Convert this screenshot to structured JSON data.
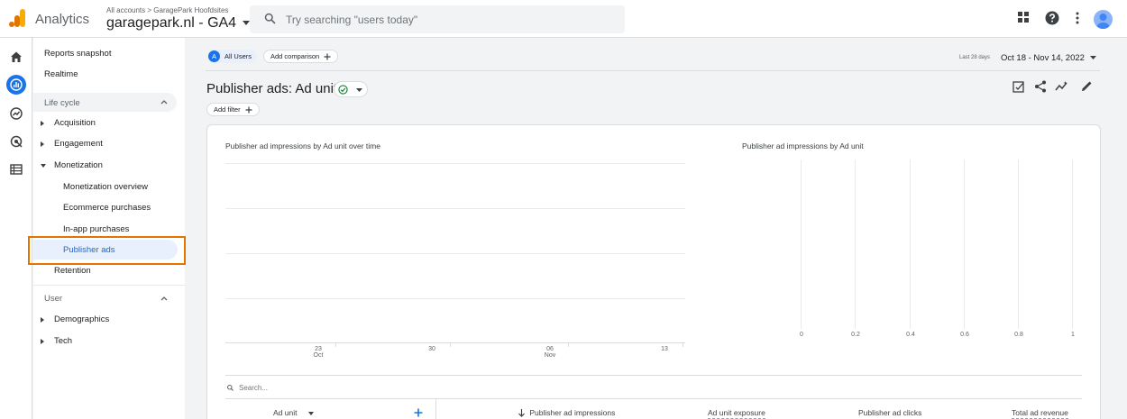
{
  "topbar": {
    "app_name": "Analytics",
    "accounts_label": "All accounts",
    "accounts_separator": ">",
    "account_name": "GaragePark Hoofdsites",
    "property_name": "garagepark.nl - GA4",
    "search_placeholder": "Try searching \"users today\"",
    "icons": [
      "apps-icon",
      "help-icon",
      "more-vert-icon",
      "avatar"
    ]
  },
  "rail": {
    "icons": [
      "home-icon",
      "reports-icon",
      "explore-icon",
      "advertising-icon",
      "configure-icon"
    ],
    "active": "reports-icon"
  },
  "nav": {
    "reports_snapshot": "Reports snapshot",
    "realtime": "Realtime",
    "lifecycle_section": "Life cycle",
    "acquisition": "Acquisition",
    "engagement": "Engagement",
    "monetization": "Monetization",
    "monetization_overview": "Monetization overview",
    "ecommerce_purchases": "Ecommerce purchases",
    "in_app_purchases": "In-app purchases",
    "publisher_ads": "Publisher ads",
    "retention": "Retention",
    "user_section": "User",
    "demographics": "Demographics",
    "tech": "Tech"
  },
  "toolbar": {
    "all_users_badge": "A",
    "all_users": "All Users",
    "add_comparison": "Add comparison",
    "date_prefix": "Last 28 days",
    "date_range": "Oct 18 - Nov 14, 2022"
  },
  "page": {
    "title": "Publisher ads: Ad unit",
    "add_filter": "Add filter"
  },
  "line_chart": {
    "title": "Publisher ad impressions by Ad unit over time",
    "x_ticks": [
      {
        "top": "23",
        "bottom": "Oct"
      },
      {
        "top": "30",
        "bottom": ""
      },
      {
        "top": "06",
        "bottom": "Nov"
      },
      {
        "top": "13",
        "bottom": ""
      }
    ]
  },
  "bar_chart": {
    "title": "Publisher ad impressions by Ad unit",
    "x_ticks": [
      "0",
      "0.2",
      "0.4",
      "0.6",
      "0.8",
      "1"
    ]
  },
  "table": {
    "search_placeholder": "Search...",
    "columns": {
      "dimension": "Ad unit",
      "impressions": "Publisher ad impressions",
      "exposure": "Ad unit exposure",
      "clicks": "Publisher ad clicks",
      "revenue": "Total ad revenue"
    }
  },
  "colors": {
    "accent": "#1a73e8",
    "highlight": "#e37400",
    "active_nav_bg": "#e8f0fe",
    "status_ok": "#188038"
  }
}
